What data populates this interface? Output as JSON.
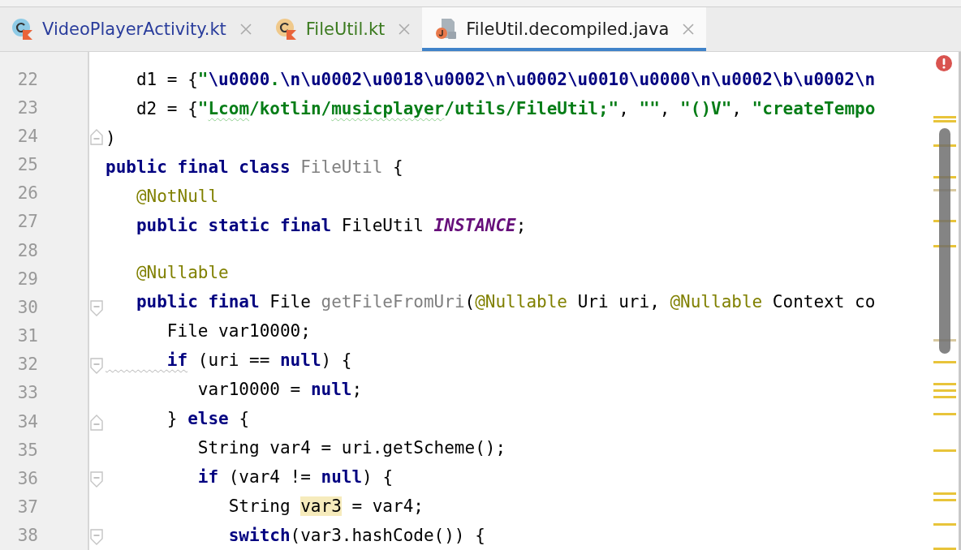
{
  "tabs": [
    {
      "label": "VideoPlayerActivity.kt",
      "kind": "kotlin-activity",
      "color": "#2a3d9c",
      "selected": false
    },
    {
      "label": "FileUtil.kt",
      "kind": "kotlin-class",
      "color": "#3b7a1f",
      "selected": false
    },
    {
      "label": "FileUtil.decompiled.java",
      "kind": "java-decompiled",
      "color": "#1a1a1a",
      "selected": true
    }
  ],
  "editor": {
    "lines": [
      {
        "number": "22",
        "kind": "plain",
        "tokens": [
          {
            "kind": "plain",
            "text": "   d1 = {"
          },
          {
            "kind": "string",
            "text": "\""
          },
          {
            "kind": "escape",
            "text": "\\u0000"
          },
          {
            "kind": "string",
            "text": "."
          },
          {
            "kind": "escape",
            "text": "\\n\\u0002\\u0018\\u0002\\n\\u0002\\u0010\\u0000\\n\\u0002\\b\\u0002\\n"
          }
        ]
      },
      {
        "number": "23",
        "kind": "plain",
        "tokens": [
          {
            "kind": "plain",
            "text": "   d2 = {"
          },
          {
            "kind": "string",
            "text": "\""
          },
          {
            "kind": "string-typo",
            "text": "Lcom"
          },
          {
            "kind": "string",
            "text": "/kotlin/"
          },
          {
            "kind": "string-typo",
            "text": "musicplayer"
          },
          {
            "kind": "string",
            "text": "/utils/FileUtil;\""
          },
          {
            "kind": "plain",
            "text": ", "
          },
          {
            "kind": "string",
            "text": "\"\""
          },
          {
            "kind": "plain",
            "text": ", "
          },
          {
            "kind": "string",
            "text": "\"()V\""
          },
          {
            "kind": "plain",
            "text": ", "
          },
          {
            "kind": "string",
            "text": "\"createTempo"
          }
        ]
      },
      {
        "number": "24",
        "kind": "fold-end",
        "tokens": [
          {
            "kind": "plain",
            "text": ")"
          }
        ]
      },
      {
        "number": "25",
        "kind": "plain",
        "tokens": [
          {
            "kind": "keyword",
            "text": "public final class "
          },
          {
            "kind": "unused",
            "text": "FileUtil"
          },
          {
            "kind": "plain",
            "text": " {"
          }
        ]
      },
      {
        "number": "26",
        "kind": "plain",
        "tokens": [
          {
            "kind": "annotation",
            "text": "   @NotNull"
          }
        ]
      },
      {
        "number": "27",
        "kind": "plain",
        "tokens": [
          {
            "kind": "keyword",
            "text": "   public static final "
          },
          {
            "kind": "plain",
            "text": "FileUtil "
          },
          {
            "kind": "static",
            "text": "INSTANCE"
          },
          {
            "kind": "plain",
            "text": ";"
          }
        ]
      },
      {
        "number": "28",
        "kind": "plain"
      },
      {
        "number": "29",
        "kind": "plain",
        "tokens": [
          {
            "kind": "annotation",
            "text": "   @Nullable"
          }
        ]
      },
      {
        "number": "30",
        "kind": "fold-start",
        "tokens": [
          {
            "kind": "keyword",
            "text": "   public final "
          },
          {
            "kind": "plain",
            "text": "File "
          },
          {
            "kind": "unused",
            "text": "getFileFromUri"
          },
          {
            "kind": "plain",
            "text": "("
          },
          {
            "kind": "annotation",
            "text": "@Nullable"
          },
          {
            "kind": "plain",
            "text": " Uri uri, "
          },
          {
            "kind": "annotation",
            "text": "@Nullable"
          },
          {
            "kind": "plain",
            "text": " Context co"
          }
        ]
      },
      {
        "number": "31",
        "kind": "plain",
        "tokens": [
          {
            "kind": "plain",
            "text": "      File var10000;"
          }
        ]
      },
      {
        "number": "32",
        "kind": "fold-start",
        "tokens": [
          {
            "kind": "keyword-warning",
            "text": "      if"
          },
          {
            "kind": "plain",
            "text": " (uri == "
          },
          {
            "kind": "keyword",
            "text": "null"
          },
          {
            "kind": "plain",
            "text": ") {"
          }
        ]
      },
      {
        "number": "33",
        "kind": "plain",
        "tokens": [
          {
            "kind": "plain",
            "text": "         var10000 = "
          },
          {
            "kind": "keyword",
            "text": "null"
          },
          {
            "kind": "plain",
            "text": ";"
          }
        ]
      },
      {
        "number": "34",
        "kind": "fold-end",
        "tokens": [
          {
            "kind": "plain",
            "text": "      } "
          },
          {
            "kind": "keyword",
            "text": "else"
          },
          {
            "kind": "plain",
            "text": " {"
          }
        ]
      },
      {
        "number": "35",
        "kind": "plain",
        "tokens": [
          {
            "kind": "plain",
            "text": "         String var4 = uri.getScheme();"
          }
        ]
      },
      {
        "number": "36",
        "kind": "fold-start",
        "tokens": [
          {
            "kind": "keyword",
            "text": "         if"
          },
          {
            "kind": "plain",
            "text": " (var4 != "
          },
          {
            "kind": "keyword",
            "text": "null"
          },
          {
            "kind": "plain",
            "text": ") {"
          }
        ]
      },
      {
        "number": "37",
        "kind": "plain",
        "tokens": [
          {
            "kind": "plain",
            "text": "            String "
          },
          {
            "kind": "highlight",
            "text": "var3"
          },
          {
            "kind": "plain",
            "text": " = var4;"
          }
        ]
      },
      {
        "number": "38",
        "kind": "fold-start",
        "tokens": [
          {
            "kind": "keyword",
            "text": "            switch"
          },
          {
            "kind": "plain",
            "text": "(var3.hashCode()) {"
          }
        ]
      }
    ]
  }
}
